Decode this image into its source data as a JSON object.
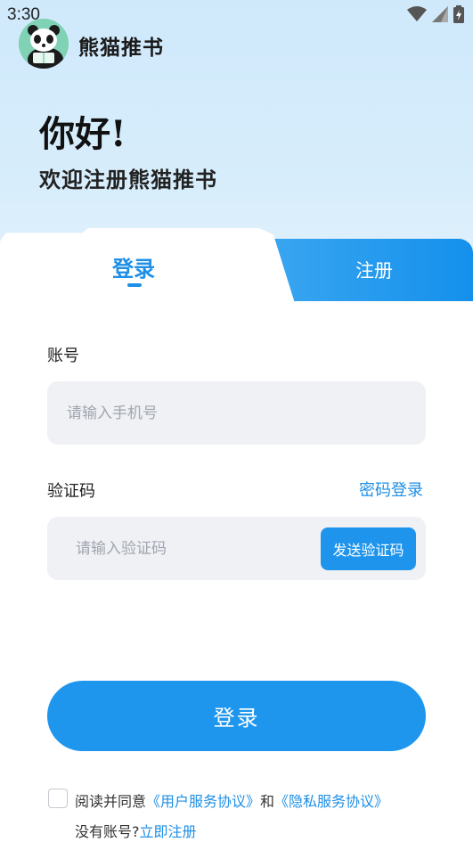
{
  "status_bar": {
    "time": "3:30",
    "wifi_icon": "wifi-icon",
    "signal_icon": "signal-icon",
    "battery_icon": "battery-charging-icon"
  },
  "header": {
    "app_name": "熊猫推书",
    "logo_icon": "panda-logo"
  },
  "hero": {
    "greeting": "你好!",
    "welcome": "欢迎注册熊猫推书"
  },
  "tabs": {
    "login": "登录",
    "register": "注册",
    "active": "login"
  },
  "form": {
    "account_label": "账号",
    "account_placeholder": "请输入手机号",
    "code_label": "验证码",
    "password_login_link": "密码登录",
    "code_placeholder": "请输入验证码",
    "send_code_button": "发送验证码"
  },
  "submit_button": "登录",
  "agreement": {
    "prefix": "阅读并同意",
    "user_agreement": "《用户服务协议》",
    "and": "和",
    "privacy_agreement": "《隐私服务协议》",
    "checked": false
  },
  "signup_prompt": {
    "text": "没有账号?",
    "link": "立即注册"
  },
  "colors": {
    "accent": "#1e96ee",
    "hero_bg": "#d3ebfb",
    "input_bg": "#eff1f5"
  }
}
